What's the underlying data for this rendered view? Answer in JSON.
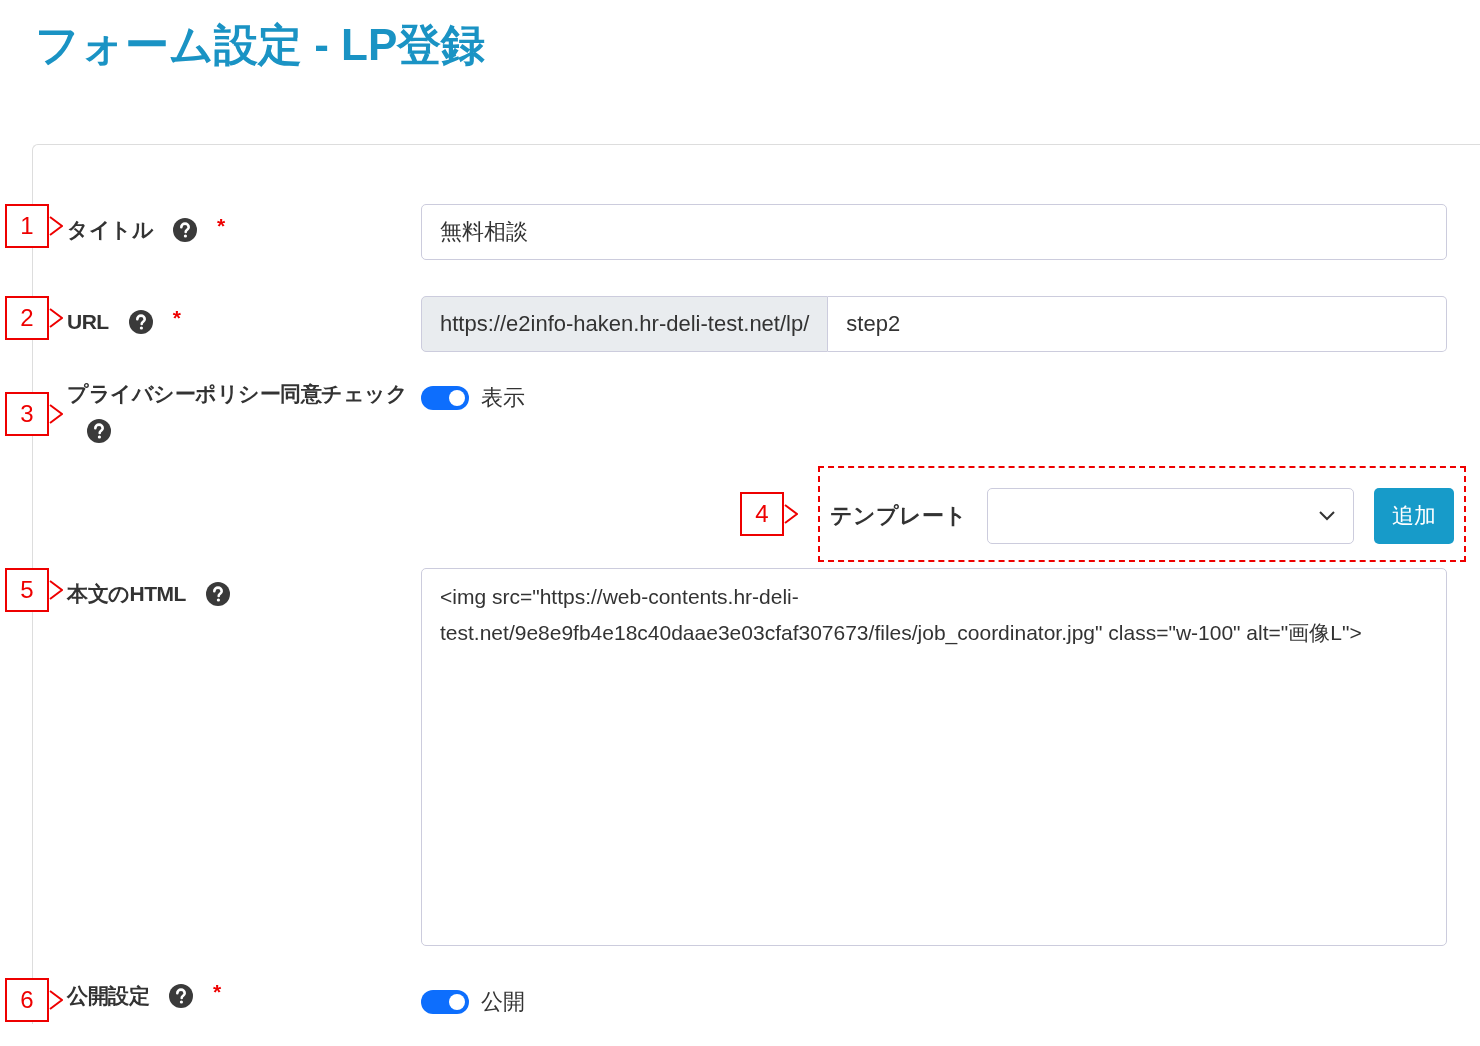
{
  "title": "フォーム設定 - LP登録",
  "fields": [
    {
      "kind": "text",
      "marker": "1",
      "label": "タイトル",
      "help": true,
      "required_mark": "*",
      "value": "無料相談"
    },
    {
      "kind": "url",
      "marker": "2",
      "label": "URL",
      "help": true,
      "required_mark": "*",
      "prefix": "https://e2info-haken.hr-deli-test.net/lp/",
      "value": "step2"
    },
    {
      "kind": "toggle",
      "marker": "3",
      "label": "プライバシーポリシー同意チェック",
      "help": true,
      "on": true,
      "text": "表示"
    },
    {
      "kind": "template",
      "marker": "4",
      "label": "テンプレート",
      "button": "追加",
      "highlighted": true
    },
    {
      "kind": "textarea",
      "marker": "5",
      "label": "本文のHTML",
      "help": true,
      "value": "<img src=\"https://web-contents.hr-deli-test.net/9e8e9fb4e18c40daae3e03cfaf307673/files/job_coordinator.jpg\" class=\"w-100\" alt=\"画像L\">"
    },
    {
      "kind": "toggle",
      "marker": "6",
      "label": "公開設定",
      "help": true,
      "required_mark": "*",
      "on": true,
      "text": "公開"
    }
  ]
}
